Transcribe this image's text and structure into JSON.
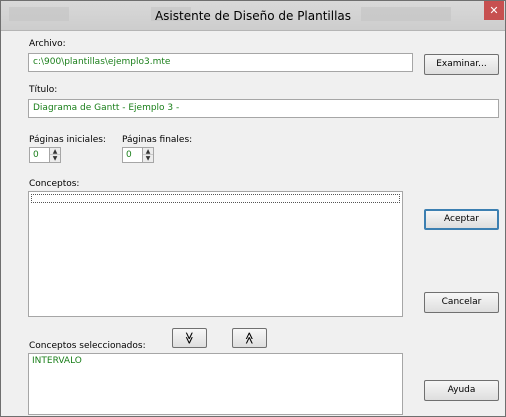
{
  "window": {
    "title": "Asistente de Diseño de Plantillas",
    "close_glyph": "✕"
  },
  "archivo": {
    "label": "Archivo:",
    "value": "c:\\900\\plantillas\\ejemplo3.mte",
    "browse_label": "Examinar..."
  },
  "titulo": {
    "label": "Título:",
    "value": "Diagrama de Gantt - Ejemplo 3 -"
  },
  "paginas_iniciales": {
    "label": "Páginas iniciales:",
    "value": "0"
  },
  "paginas_finales": {
    "label": "Páginas finales:",
    "value": "0"
  },
  "conceptos": {
    "label": "Conceptos:",
    "items": []
  },
  "buttons": {
    "aceptar": "Aceptar",
    "cancelar": "Cancelar",
    "ayuda": "Ayuda"
  },
  "move_buttons": {
    "down_glyph": "≫",
    "up_glyph": "≪",
    "down_icon": "double-chevron-down-icon",
    "up_icon": "double-chevron-up-icon"
  },
  "conceptos_seleccionados": {
    "label": "Conceptos seleccionados:",
    "items": [
      "INTERVALO"
    ]
  },
  "colors": {
    "value_text": "#1a7f1a",
    "default_button_border": "#3c7fb1",
    "close_button": "#c75050"
  }
}
